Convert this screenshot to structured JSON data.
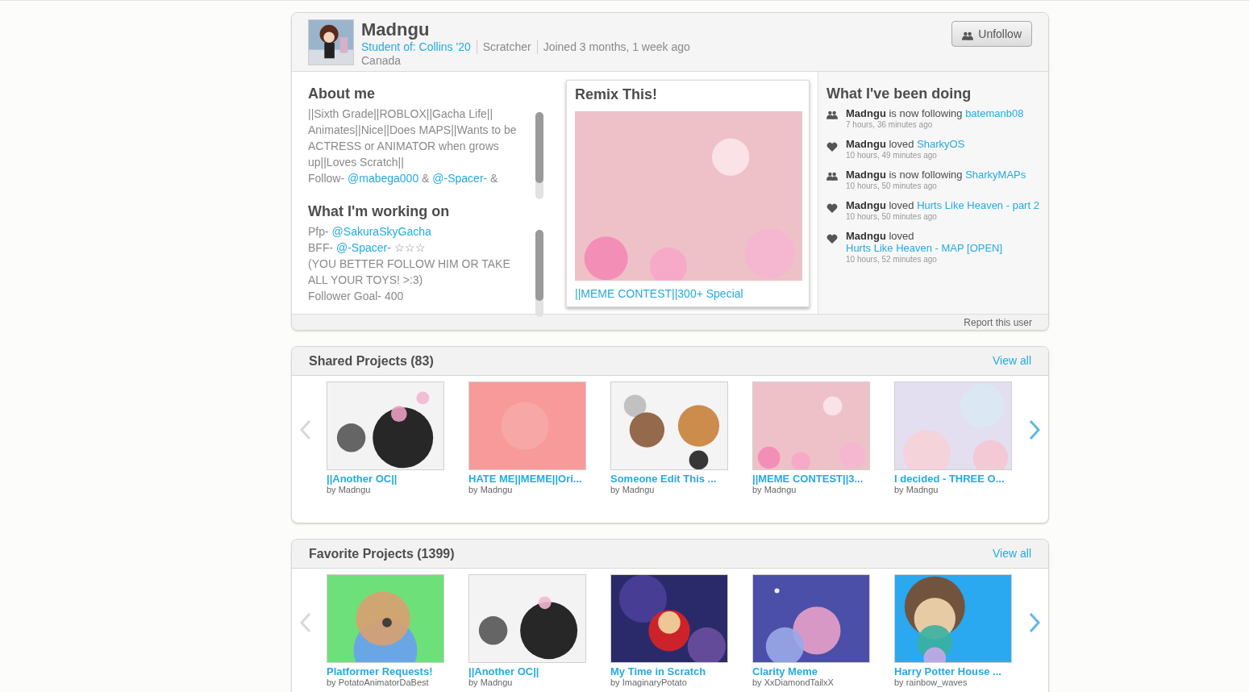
{
  "profile": {
    "username": "Madngu",
    "school": "Student of: Collins '20",
    "role": "Scratcher",
    "joined": "Joined 3 months, 1 week ago",
    "country": "Canada",
    "follow_button": "Unfollow"
  },
  "about": {
    "title": "About me",
    "paragraphs": [
      [
        {
          "kind": "text",
          "text": "||Sixth Grade||ROBLOX||Gacha Life|| Animates||Nice||Does MAPS||Wants to be ACTRESS or ANIMATOR when grows up||Loves Scratch||"
        }
      ],
      [
        {
          "kind": "text",
          "text": "Follow- "
        },
        {
          "kind": "link",
          "text": "@mabega000"
        },
        {
          "kind": "text",
          "text": " & "
        },
        {
          "kind": "link",
          "text": "@-Spacer-"
        },
        {
          "kind": "text",
          "text": " &"
        }
      ]
    ]
  },
  "working_on": {
    "title": "What I'm working on",
    "paragraphs": [
      [
        {
          "kind": "text",
          "text": "Pfp- "
        },
        {
          "kind": "link",
          "text": "@SakuraSkyGacha"
        }
      ],
      [
        {
          "kind": "text",
          "text": "BFF- "
        },
        {
          "kind": "link",
          "text": "@-Spacer-"
        },
        {
          "kind": "text",
          "text": " ☆☆☆"
        }
      ],
      [
        {
          "kind": "text",
          "text": "(YOU BETTER FOLLOW HIM OR TAKE ALL YOUR TOYS! >:3)"
        }
      ],
      [
        {
          "kind": "text",
          "text": "Follower Goal- 400"
        }
      ]
    ]
  },
  "featured": {
    "title": "Remix This!",
    "project_title": "||MEME CONTEST||300+ Special"
  },
  "activity": {
    "title": "What I've been doing",
    "items": [
      {
        "kind": "follow",
        "user": "Madngu",
        "verb": "is now following",
        "target": "batemanb08",
        "time": "7 hours, 36 minutes ago"
      },
      {
        "kind": "love",
        "user": "Madngu",
        "verb": "loved",
        "target": "SharkyOS",
        "time": "10 hours, 49 minutes ago"
      },
      {
        "kind": "follow",
        "user": "Madngu",
        "verb": "is now following",
        "target": "SharkyMAPs",
        "time": "10 hours, 50 minutes ago"
      },
      {
        "kind": "love",
        "user": "Madngu",
        "verb": "loved",
        "target": "Hurts Like Heaven - part 2",
        "time": "10 hours, 50 minutes ago"
      },
      {
        "kind": "love",
        "user": "Madngu",
        "verb": "loved",
        "target": "Hurts Like Heaven - MAP [OPEN]",
        "time": "10 hours, 52 minutes ago"
      }
    ]
  },
  "report_link": "Report this user",
  "carousels": [
    {
      "title": "Shared Projects (83)",
      "view_all": "View all",
      "prev_enabled": false,
      "next_enabled": true,
      "projects": [
        {
          "title": "||Another OC||",
          "author": "by Madngu"
        },
        {
          "title": "HATE ME||MEME||Ori...",
          "author": "by Madngu"
        },
        {
          "title": "Someone Edit This ...",
          "author": "by Madngu"
        },
        {
          "title": "||MEME CONTEST||3...",
          "author": "by Madngu"
        },
        {
          "title": "I decided - THREE O...",
          "author": "by Madngu"
        }
      ]
    },
    {
      "title": "Favorite Projects (1399)",
      "view_all": "View all",
      "prev_enabled": false,
      "next_enabled": true,
      "projects": [
        {
          "title": "Platformer Requests!",
          "author": "by PotatoAnimatorDaBest"
        },
        {
          "title": "||Another OC||",
          "author": "by Madngu"
        },
        {
          "title": "My Time in Scratch",
          "author": "by ImaginaryPotato"
        },
        {
          "title": "Clarity Meme",
          "author": "by XxDiamondTailxX"
        },
        {
          "title": "Harry Potter House ...",
          "author": "by rainbow_waves"
        }
      ]
    }
  ]
}
